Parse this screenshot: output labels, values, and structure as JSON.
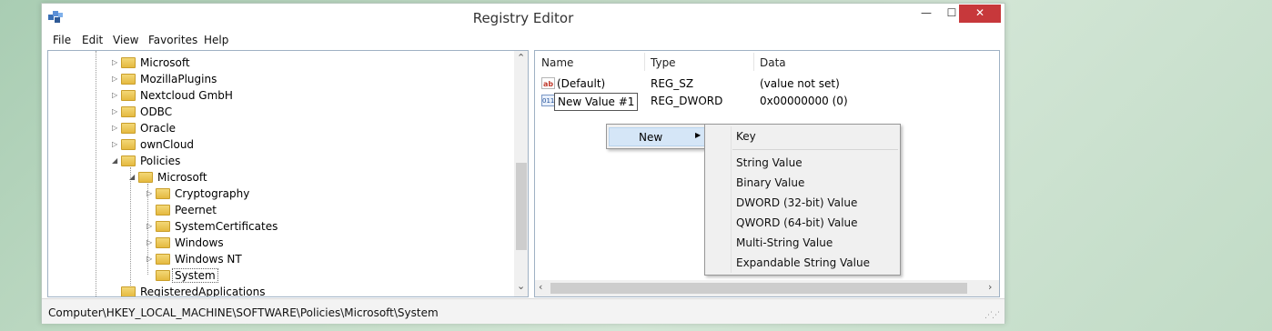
{
  "window": {
    "title": "Registry Editor",
    "min_glyph": "—",
    "max_glyph": "☐",
    "close_glyph": "✕"
  },
  "menu": [
    "File",
    "Edit",
    "View",
    "Favorites",
    "Help"
  ],
  "tree": [
    {
      "label": "Microsoft",
      "expander": "▷",
      "level": 0
    },
    {
      "label": "MozillaPlugins",
      "expander": "▷",
      "level": 0
    },
    {
      "label": "Nextcloud GmbH",
      "expander": "▷",
      "level": 0
    },
    {
      "label": "ODBC",
      "expander": "▷",
      "level": 0
    },
    {
      "label": "Oracle",
      "expander": "▷",
      "level": 0
    },
    {
      "label": "ownCloud",
      "expander": "▷",
      "level": 0
    },
    {
      "label": "Policies",
      "expander": "◢",
      "level": 0
    },
    {
      "label": "Microsoft",
      "expander": "◢",
      "level": 1
    },
    {
      "label": "Cryptography",
      "expander": "▷",
      "level": 2
    },
    {
      "label": "Peernet",
      "expander": "",
      "level": 2
    },
    {
      "label": "SystemCertificates",
      "expander": "▷",
      "level": 2
    },
    {
      "label": "Windows",
      "expander": "▷",
      "level": 2
    },
    {
      "label": "Windows NT",
      "expander": "▷",
      "level": 2
    },
    {
      "label": "System",
      "expander": "",
      "level": 2,
      "selected": true
    },
    {
      "label": "RegisteredApplications",
      "expander": "",
      "level": 0
    }
  ],
  "list": {
    "columns": [
      "Name",
      "Type",
      "Data"
    ],
    "rows": [
      {
        "name": "(Default)",
        "type": "REG_SZ",
        "data": "(value not set)",
        "icon": "ab"
      },
      {
        "name": "New Value #1",
        "type": "REG_DWORD",
        "data": "0x00000000 (0)",
        "icon": "011"
      }
    ]
  },
  "context_menu": {
    "new_label": "New",
    "submenu": [
      "Key",
      "String Value",
      "Binary Value",
      "DWORD (32-bit) Value",
      "QWORD (64-bit) Value",
      "Multi-String Value",
      "Expandable String Value"
    ]
  },
  "status": "Computer\\HKEY_LOCAL_MACHINE\\SOFTWARE\\Policies\\Microsoft\\System",
  "scroll": {
    "up": "⌃",
    "down": "⌄",
    "left": "‹",
    "right": "›"
  },
  "grip": "⋰⋰"
}
